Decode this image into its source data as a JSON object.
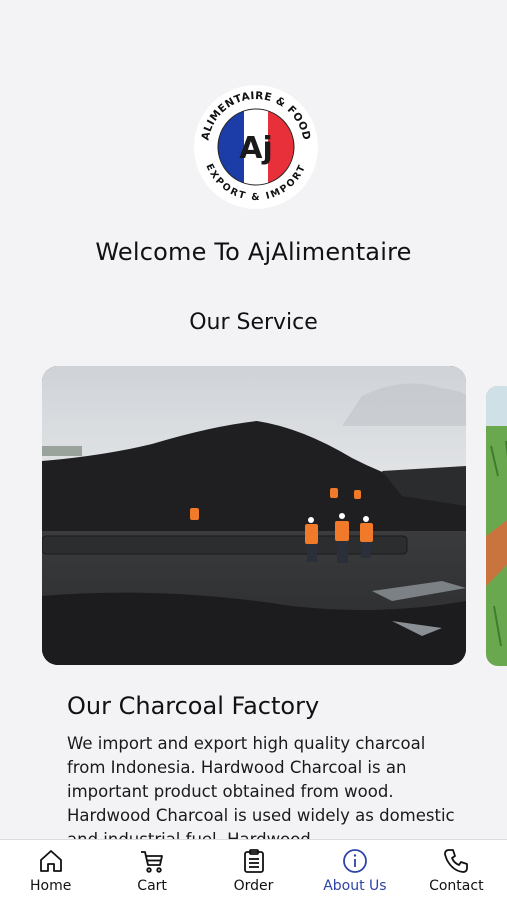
{
  "logo": {
    "top_text": "ALIMENTAIRE & FOOD",
    "bottom_text": "EXPORT & IMPORT",
    "monogram": "Aj",
    "colors": {
      "blue": "#1c3da8",
      "white": "#ffffff",
      "red": "#e8303a"
    }
  },
  "welcome_text": "Welcome To AjAlimentaire",
  "service_title": "Our Service",
  "card": {
    "heading": "Our Charcoal Factory",
    "description": "We import and export high quality charcoal from Indonesia. Hardwood Charcoal is an important product obtained from wood. Hardwood Charcoal is used widely as domestic and industrial fuel. Hardwood"
  },
  "nav": {
    "items": [
      {
        "label": "Home",
        "icon": "home-icon"
      },
      {
        "label": "Cart",
        "icon": "cart-icon"
      },
      {
        "label": "Order",
        "icon": "clipboard-icon"
      },
      {
        "label": "About Us",
        "icon": "info-icon"
      },
      {
        "label": "Contact",
        "icon": "phone-icon"
      }
    ],
    "active": "About Us",
    "active_color": "#2d43a8"
  }
}
